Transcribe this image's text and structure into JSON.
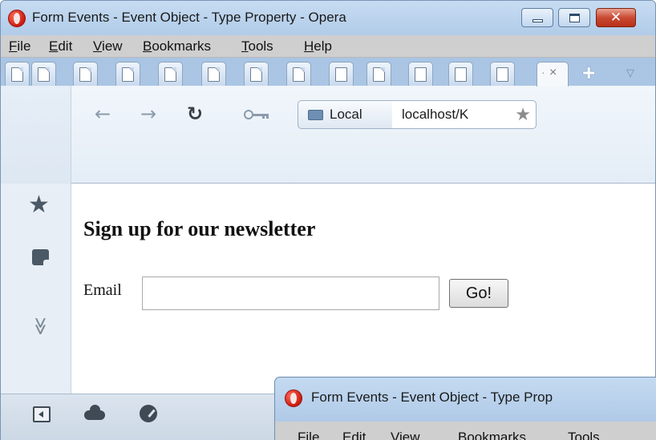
{
  "window": {
    "title": "Form Events - Event Object - Type Property - Opera",
    "controls": {
      "close": "✕"
    }
  },
  "menubar": [
    {
      "mnemonic": "F",
      "rest": "ile"
    },
    {
      "mnemonic": "E",
      "rest": "dit"
    },
    {
      "mnemonic": "V",
      "rest": "iew"
    },
    {
      "mnemonic": "B",
      "rest": "ookmarks"
    },
    {
      "mnemonic": "T",
      "rest": "ools"
    },
    {
      "mnemonic": "H",
      "rest": "elp"
    }
  ],
  "tabs": {
    "count": 13,
    "active_close": "×"
  },
  "toolbar": {
    "back": "←",
    "forward": "→",
    "reload": "↻",
    "address_badge": "Local",
    "address": "localhost/K",
    "bookmark_star": "★"
  },
  "sidepanel": {
    "bookmarks": "★",
    "more": "≫"
  },
  "page": {
    "heading": "Sign up for our newsletter",
    "email_label": "Email",
    "email_value": "",
    "go_label": "Go!"
  },
  "window2": {
    "title": "Form Events - Event Object - Type Prop",
    "menubar": [
      "File",
      "Edit",
      "View",
      "Bookmarks",
      "Tools"
    ]
  }
}
